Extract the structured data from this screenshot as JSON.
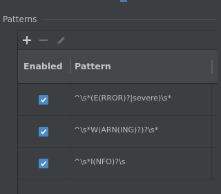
{
  "group": {
    "title": "Patterns"
  },
  "toolbar": {
    "add_icon": "plus-icon",
    "remove_icon": "minus-icon",
    "edit_icon": "pencil-icon"
  },
  "table": {
    "columns": [
      "Enabled",
      "Pattern"
    ],
    "rows": [
      {
        "enabled": true,
        "pattern": "^\\s*(E(RROR)?|severe)\\s*"
      },
      {
        "enabled": true,
        "pattern": "^\\s*W(ARN(ING)?)?\\s*"
      },
      {
        "enabled": true,
        "pattern": "^\\s*I(NFO)?\\s"
      }
    ]
  },
  "colors": {
    "accent": "#4a88c7",
    "background": "#3c3f41",
    "header": "#45484a"
  }
}
